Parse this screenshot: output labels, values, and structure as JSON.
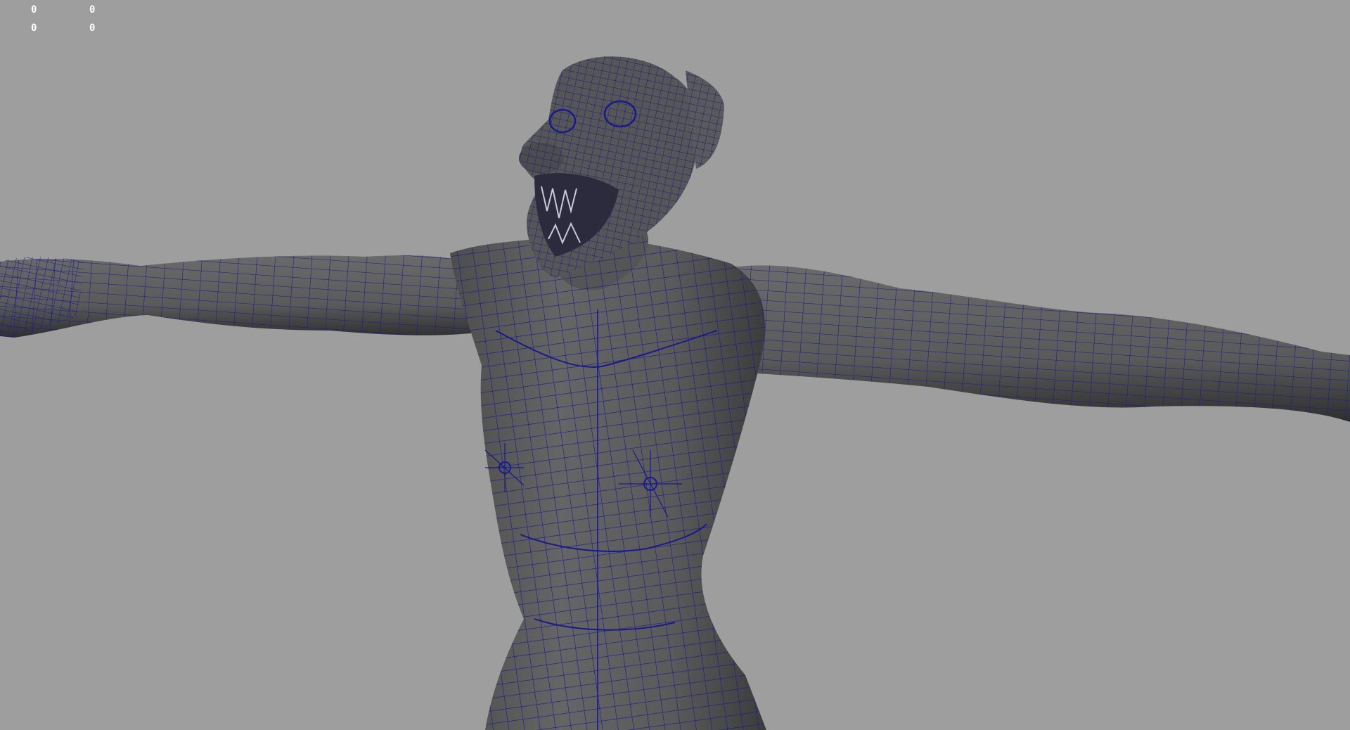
{
  "viewport": {
    "background": "#9e9e9e",
    "mesh_fill": "#5c5c5c",
    "mesh_shade": "#4a4a4a",
    "mesh_highlight": "#6e6e6e",
    "wire_color": "#1a1a8c"
  },
  "heads_up_display": {
    "rows": [
      [
        "0",
        "0"
      ],
      [
        "0",
        "0"
      ]
    ]
  },
  "model": {
    "icon": "wireframe-creature-mesh"
  }
}
